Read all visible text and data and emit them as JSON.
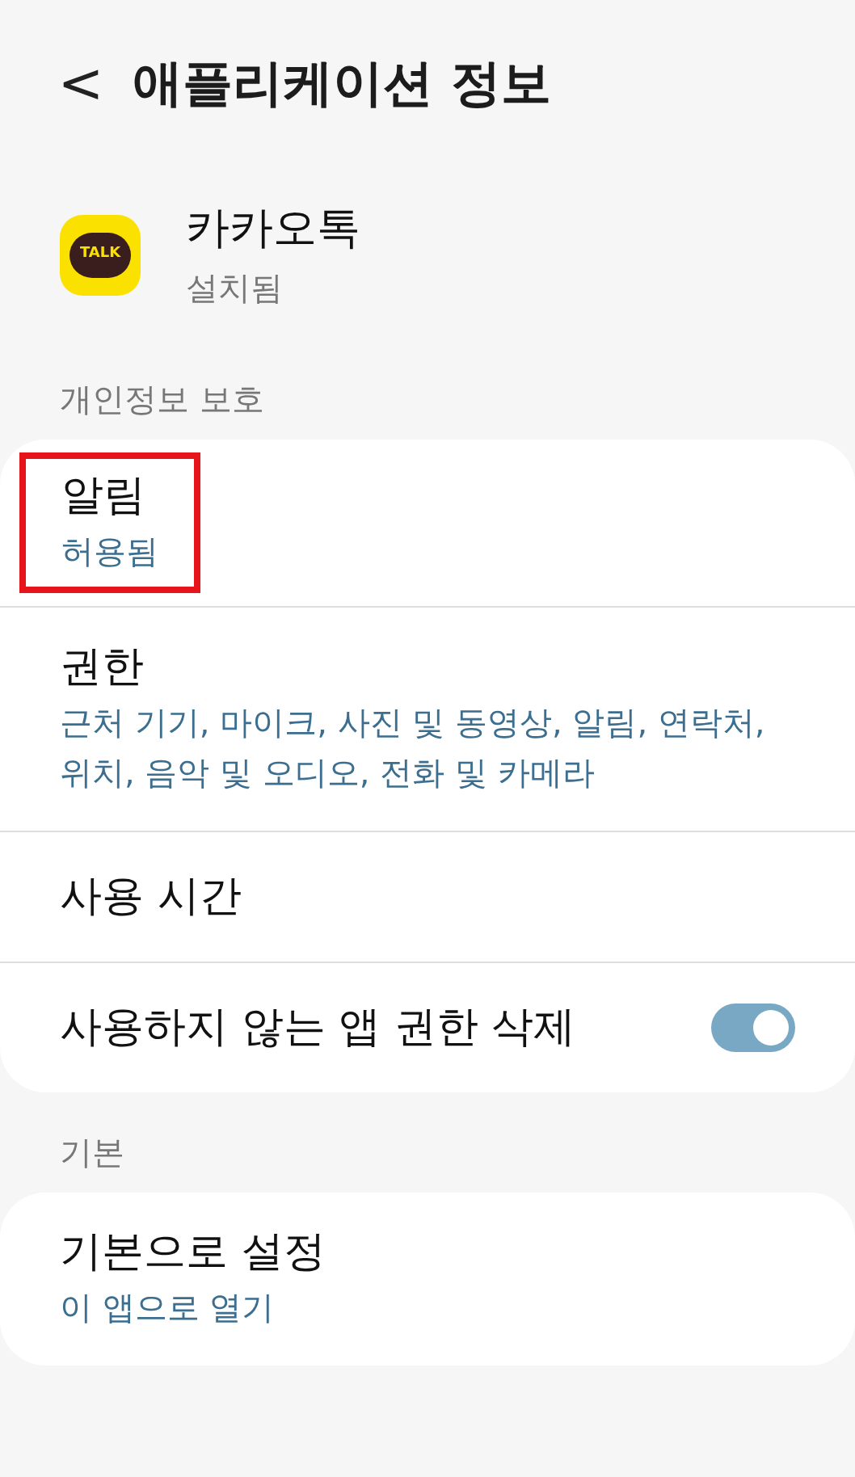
{
  "header": {
    "back": "<",
    "title": "애플리케이션 정보"
  },
  "app": {
    "icon_text": "TALK",
    "name": "카카오톡",
    "status": "설치됨"
  },
  "sections": [
    {
      "title": "개인정보 보호",
      "items": [
        {
          "kind": "link",
          "label": "알림",
          "subtitle": "허용됨",
          "highlighted": true
        },
        {
          "kind": "link",
          "label": "권한",
          "subtitle": "근처 기기, 마이크, 사진 및 동영상, 알림, 연락처, 위치, 음악 및 오디오, 전화 및 카메라",
          "highlighted": false
        },
        {
          "kind": "link",
          "label": "사용 시간",
          "highlighted": false
        },
        {
          "kind": "toggle",
          "label": "사용하지 않는 앱 권한 삭제",
          "on": true,
          "highlighted": false
        }
      ]
    },
    {
      "title": "기본",
      "items": [
        {
          "kind": "link",
          "label": "기본으로 설정",
          "subtitle": "이 앱으로 열기",
          "highlighted": false
        }
      ]
    }
  ]
}
